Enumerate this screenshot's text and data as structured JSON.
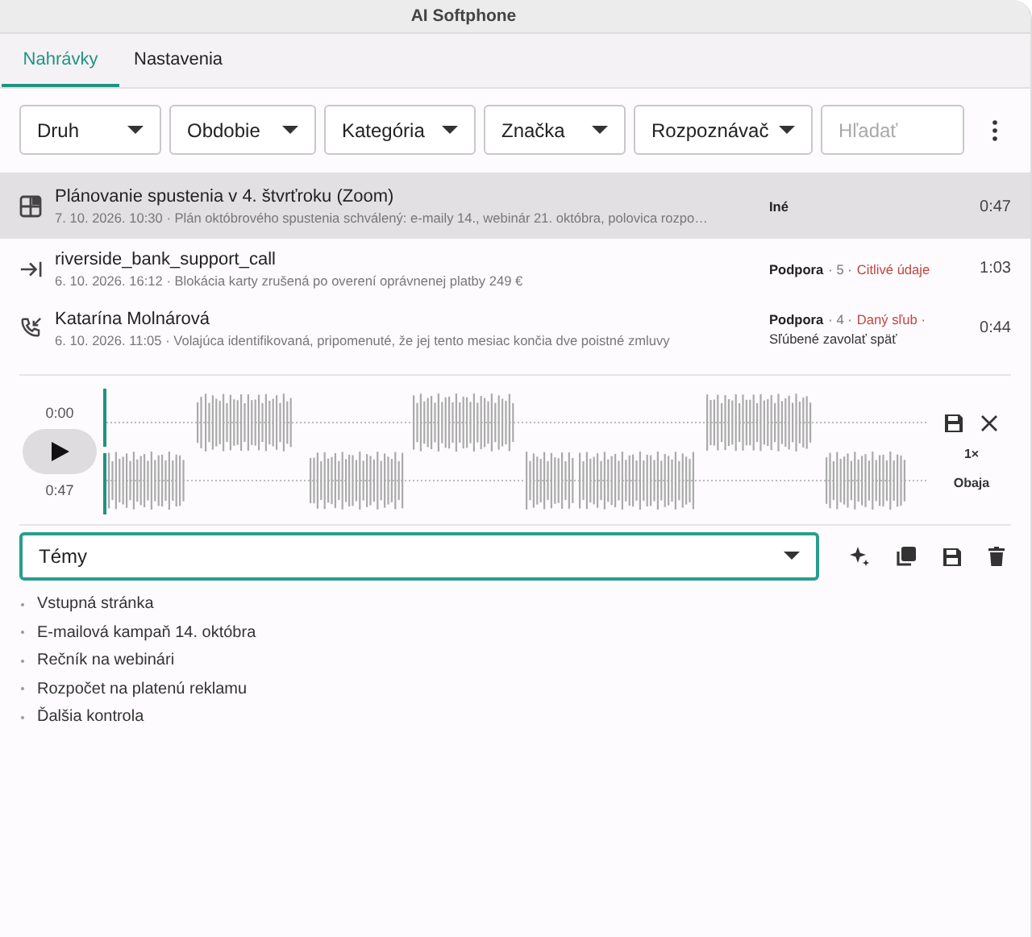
{
  "window": {
    "title": "AI Softphone"
  },
  "tabs": [
    {
      "label": "Nahrávky",
      "selected": true
    },
    {
      "label": "Nastavenia",
      "selected": false
    }
  ],
  "filters": [
    {
      "label": "Druh"
    },
    {
      "label": "Obdobie"
    },
    {
      "label": "Kategória"
    },
    {
      "label": "Značka"
    },
    {
      "label": "Rozpoznávač"
    }
  ],
  "search": {
    "placeholder": "Hľadať"
  },
  "recordings": [
    {
      "kind": "meeting",
      "selected": true,
      "title": "Plánovanie spustenia v 4. štvrťroku (Zoom)",
      "subtitle": "7. 10. 2026. 10:30  ·  Plán októbrového spustenia schválený: e-maily 14., webinár 21. októbra, polovica rozpo…",
      "meta": [
        {
          "kind": "category",
          "text": "Iné"
        }
      ],
      "duration": "0:47"
    },
    {
      "kind": "outgoing",
      "selected": false,
      "title": "riverside_bank_support_call",
      "subtitle": "6. 10. 2026. 16:12  ·  Blokácia karty zrušená po overení oprávnenej platby 249 €",
      "meta": [
        {
          "kind": "category",
          "text": "Podpora"
        },
        {
          "kind": "plain",
          "text": "· 5 ·"
        },
        {
          "kind": "alert",
          "text": "Citlivé údaje"
        }
      ],
      "duration": "1:03"
    },
    {
      "kind": "incoming",
      "selected": false,
      "title": "Katarína Molnárová",
      "subtitle": "6. 10. 2026. 11:05  ·  Volajúca identifikovaná, pripomenuté, že jej tento mesiac končia dve poistné zmluvy",
      "meta": [
        {
          "kind": "category",
          "text": "Podpora"
        },
        {
          "kind": "plain",
          "text": "· 4 ·"
        },
        {
          "kind": "alert",
          "text": "Daný sľub ·"
        },
        {
          "kind": "note",
          "text": "Sľúbené zavolať späť"
        }
      ],
      "duration": "0:44"
    }
  ],
  "player": {
    "start": "0:00",
    "end": "0:47",
    "speed": "1×",
    "channels": "Obaja"
  },
  "topics": {
    "value": "Témy",
    "items": [
      "Vstupná stránka",
      "E-mailová kampaň 14. októbra",
      "Rečník na webinári",
      "Rozpočet na platenú reklamu",
      "Ďalšia kontrola"
    ]
  }
}
